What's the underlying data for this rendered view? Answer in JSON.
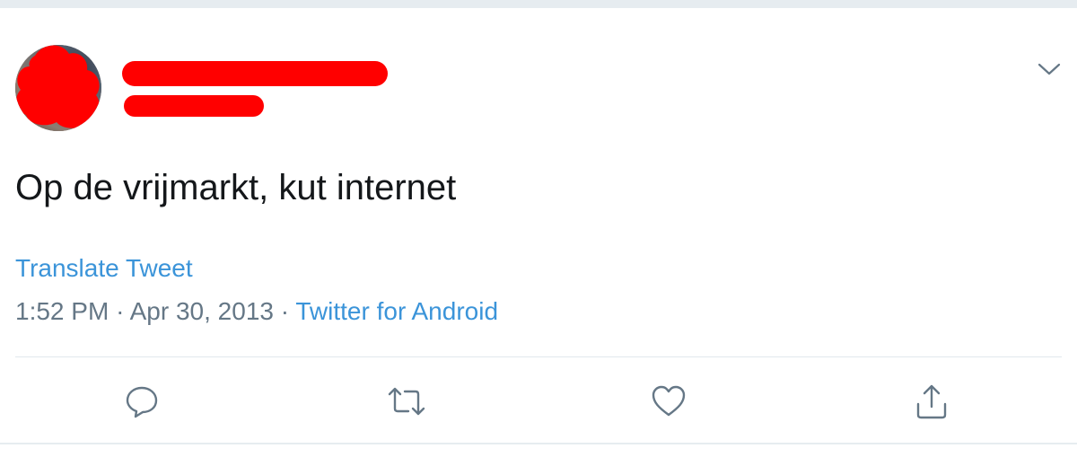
{
  "tweet": {
    "text": "Op de vrijmarkt, kut internet",
    "translate_label": "Translate Tweet",
    "time": "1:52 PM",
    "separator": "·",
    "date": "Apr 30, 2013",
    "source": "Twitter for Android"
  },
  "icons": {
    "more": "chevron-down-icon",
    "reply": "reply-icon",
    "retweet": "retweet-icon",
    "like": "heart-icon",
    "share": "share-icon"
  },
  "colors": {
    "link": "#3b94d9",
    "text": "#14171a",
    "muted": "#657786",
    "redaction": "#ff0000",
    "icon": "#657786"
  }
}
